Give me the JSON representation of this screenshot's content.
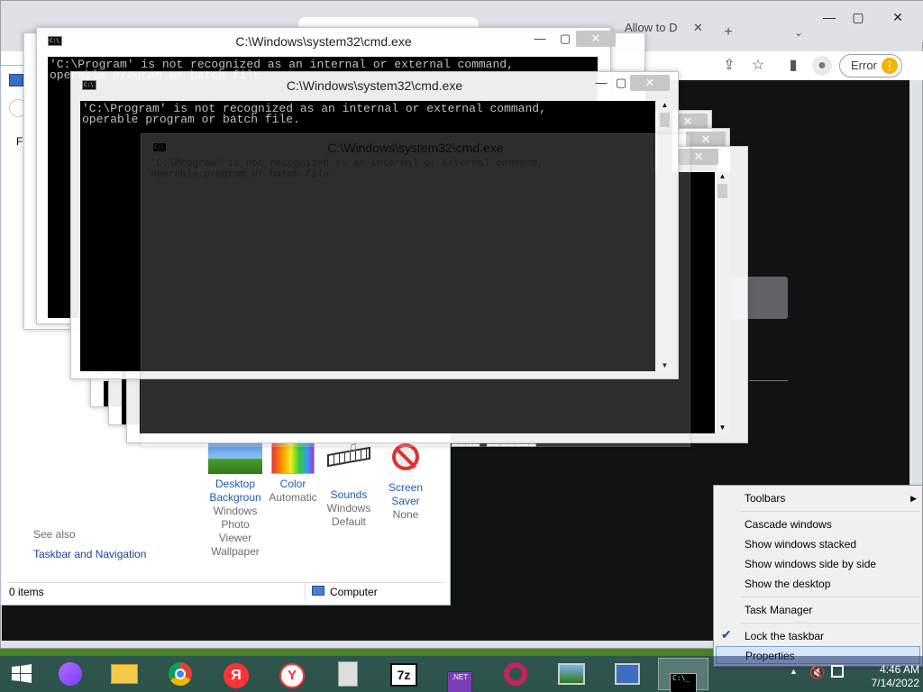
{
  "browser": {
    "tab_label": "Allow to D",
    "new_tab": "+",
    "error_label": "Error",
    "error_dots": "⋮"
  },
  "explorer": {
    "see_also": "See also",
    "taskbar_link": "Taskbar and Navigation",
    "items_count": "0 items",
    "location": "Computer",
    "frag_m": "M",
    "frag_fi": "Fi",
    "personalize": [
      {
        "title": "Desktop Backgroun",
        "sub": "Windows Photo Viewer Wallpaper"
      },
      {
        "title": "Color",
        "sub": "Automatic"
      },
      {
        "title": "Sounds",
        "sub": "Windows Default"
      },
      {
        "title": "Screen Saver",
        "sub": "None"
      }
    ]
  },
  "cmd": {
    "title": "C:\\Windows\\system32\\cmd.exe",
    "line1": "'C:\\Program' is not recognized as an internal or external command,",
    "line2": "operable program or batch file."
  },
  "context_menu": {
    "toolbars": "Toolbars",
    "cascade": "Cascade windows",
    "stacked": "Show windows stacked",
    "side_by_side": "Show windows side by side",
    "show_desktop": "Show the desktop",
    "task_manager": "Task Manager",
    "lock_taskbar": "Lock the taskbar",
    "properties": "Properties",
    "lock_checked": true
  },
  "taskbar": {
    "time": "4:46 AM",
    "date": "7/14/2022",
    "apps": [
      "start",
      "alice",
      "file-explorer",
      "chrome",
      "yandex-ya",
      "yandex-browser",
      "archive",
      "7zip",
      "dotnet",
      "opera",
      "control-panel",
      "network-config",
      "cmd"
    ]
  },
  "colors": {
    "accent": "#1e5bb3",
    "menu_highlight": "#d6e6f9",
    "console_bg": "#000000"
  }
}
